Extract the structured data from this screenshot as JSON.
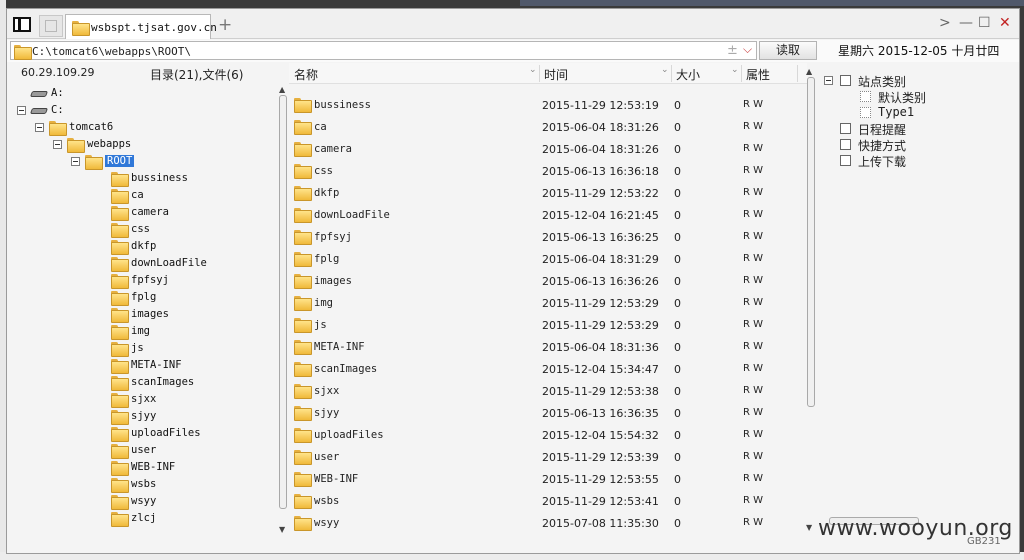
{
  "window": {
    "tab_title": "wsbspt.tjsat.gov.cn",
    "new_tab": "+",
    "nav_next": ">",
    "minimize": "—",
    "maximize": "☐",
    "close": "✕"
  },
  "address": {
    "path": "C:\\tomcat6\\webapps\\ROOT\\",
    "read_button": "读取",
    "date": "星期六 2015-12-05 十月廿四"
  },
  "left_panel": {
    "ip": "60.29.109.29",
    "summary": "目录(21),文件(6)",
    "tree": [
      {
        "label": "A:",
        "level": 0,
        "type": "drive",
        "expanded": false
      },
      {
        "label": "C:",
        "level": 0,
        "type": "drive",
        "expanded": true
      },
      {
        "label": "tomcat6",
        "level": 1,
        "type": "folder",
        "expanded": true
      },
      {
        "label": "webapps",
        "level": 2,
        "type": "folder",
        "expanded": true
      },
      {
        "label": "ROOT",
        "level": 3,
        "type": "folder",
        "expanded": true,
        "selected": true
      },
      {
        "label": "bussiness",
        "level": 4,
        "type": "folder"
      },
      {
        "label": "ca",
        "level": 4,
        "type": "folder"
      },
      {
        "label": "camera",
        "level": 4,
        "type": "folder"
      },
      {
        "label": "css",
        "level": 4,
        "type": "folder"
      },
      {
        "label": "dkfp",
        "level": 4,
        "type": "folder"
      },
      {
        "label": "downLoadFile",
        "level": 4,
        "type": "folder"
      },
      {
        "label": "fpfsyj",
        "level": 4,
        "type": "folder"
      },
      {
        "label": "fplg",
        "level": 4,
        "type": "folder"
      },
      {
        "label": "images",
        "level": 4,
        "type": "folder"
      },
      {
        "label": "img",
        "level": 4,
        "type": "folder"
      },
      {
        "label": "js",
        "level": 4,
        "type": "folder"
      },
      {
        "label": "META-INF",
        "level": 4,
        "type": "folder"
      },
      {
        "label": "scanImages",
        "level": 4,
        "type": "folder"
      },
      {
        "label": "sjxx",
        "level": 4,
        "type": "folder"
      },
      {
        "label": "sjyy",
        "level": 4,
        "type": "folder"
      },
      {
        "label": "uploadFiles",
        "level": 4,
        "type": "folder"
      },
      {
        "label": "user",
        "level": 4,
        "type": "folder"
      },
      {
        "label": "WEB-INF",
        "level": 4,
        "type": "folder"
      },
      {
        "label": "wsbs",
        "level": 4,
        "type": "folder"
      },
      {
        "label": "wsyy",
        "level": 4,
        "type": "folder"
      },
      {
        "label": "zlcj",
        "level": 4,
        "type": "folder"
      }
    ]
  },
  "file_list": {
    "columns": [
      "名称",
      "时间",
      "大小",
      "属性"
    ],
    "rows": [
      {
        "name": "bussiness",
        "time": "2015-11-29 12:53:19",
        "size": "0",
        "attr": "R W"
      },
      {
        "name": "ca",
        "time": "2015-06-04 18:31:26",
        "size": "0",
        "attr": "R W"
      },
      {
        "name": "camera",
        "time": "2015-06-04 18:31:26",
        "size": "0",
        "attr": "R W"
      },
      {
        "name": "css",
        "time": "2015-06-13 16:36:18",
        "size": "0",
        "attr": "R W"
      },
      {
        "name": "dkfp",
        "time": "2015-11-29 12:53:22",
        "size": "0",
        "attr": "R W"
      },
      {
        "name": "downLoadFile",
        "time": "2015-12-04 16:21:45",
        "size": "0",
        "attr": "R W"
      },
      {
        "name": "fpfsyj",
        "time": "2015-06-13 16:36:25",
        "size": "0",
        "attr": "R W"
      },
      {
        "name": "fplg",
        "time": "2015-06-04 18:31:29",
        "size": "0",
        "attr": "R W"
      },
      {
        "name": "images",
        "time": "2015-06-13 16:36:26",
        "size": "0",
        "attr": "R W"
      },
      {
        "name": "img",
        "time": "2015-11-29 12:53:29",
        "size": "0",
        "attr": "R W"
      },
      {
        "name": "js",
        "time": "2015-11-29 12:53:29",
        "size": "0",
        "attr": "R W"
      },
      {
        "name": "META-INF",
        "time": "2015-06-04 18:31:36",
        "size": "0",
        "attr": "R W"
      },
      {
        "name": "scanImages",
        "time": "2015-12-04 15:34:47",
        "size": "0",
        "attr": "R W"
      },
      {
        "name": "sjxx",
        "time": "2015-11-29 12:53:38",
        "size": "0",
        "attr": "R W"
      },
      {
        "name": "sjyy",
        "time": "2015-06-13 16:36:35",
        "size": "0",
        "attr": "R W"
      },
      {
        "name": "uploadFiles",
        "time": "2015-12-04 15:54:32",
        "size": "0",
        "attr": "R W"
      },
      {
        "name": "user",
        "time": "2015-11-29 12:53:39",
        "size": "0",
        "attr": "R W"
      },
      {
        "name": "WEB-INF",
        "time": "2015-11-29 12:53:55",
        "size": "0",
        "attr": "R W"
      },
      {
        "name": "wsbs",
        "time": "2015-11-29 12:53:41",
        "size": "0",
        "attr": "R W"
      },
      {
        "name": "wsyy",
        "time": "2015-07-08 11:35:30",
        "size": "0",
        "attr": "R W"
      }
    ]
  },
  "side_panel": {
    "items": [
      {
        "label": "站点类别",
        "level": 0,
        "icon": "category-icon",
        "expanded": true
      },
      {
        "label": "默认类别",
        "level": 1,
        "icon": "folder-outline-icon"
      },
      {
        "label": "Type1",
        "level": 1,
        "icon": "folder-outline-icon"
      },
      {
        "label": "日程提醒",
        "level": 0,
        "icon": "reminder-icon"
      },
      {
        "label": "快捷方式",
        "level": 0,
        "icon": "shortcut-icon"
      },
      {
        "label": "上传下载",
        "level": 0,
        "icon": "transfer-icon"
      }
    ]
  },
  "watermark": {
    "text": "www.wooyun.org",
    "sub": "GB231"
  },
  "colors": {
    "selection": "#3078d8",
    "folder": "#f0b93a",
    "close": "#c22222"
  }
}
